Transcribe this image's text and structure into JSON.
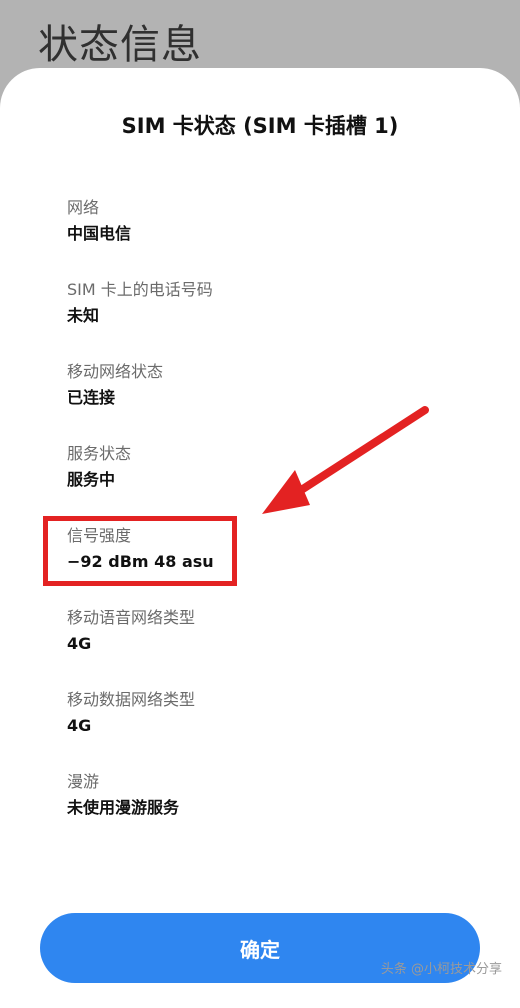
{
  "header": {
    "title": "状态信息"
  },
  "dialog": {
    "title": "SIM 卡状态 (SIM 卡插槽 1)",
    "items": [
      {
        "label": "网络",
        "value": "中国电信"
      },
      {
        "label": "SIM 卡上的电话号码",
        "value": "未知"
      },
      {
        "label": "移动网络状态",
        "value": "已连接"
      },
      {
        "label": "服务状态",
        "value": "服务中"
      },
      {
        "label": "信号强度",
        "value": "−92 dBm 48 asu"
      },
      {
        "label": "移动语音网络类型",
        "value": "4G"
      },
      {
        "label": "移动数据网络类型",
        "value": "4G"
      },
      {
        "label": "漫游",
        "value": "未使用漫游服务"
      }
    ],
    "confirm_label": "确定"
  },
  "watermark": {
    "text": "头条 @小柯技术分享"
  },
  "colors": {
    "accent_button": "#2f86f0",
    "highlight_red": "#e32222"
  }
}
